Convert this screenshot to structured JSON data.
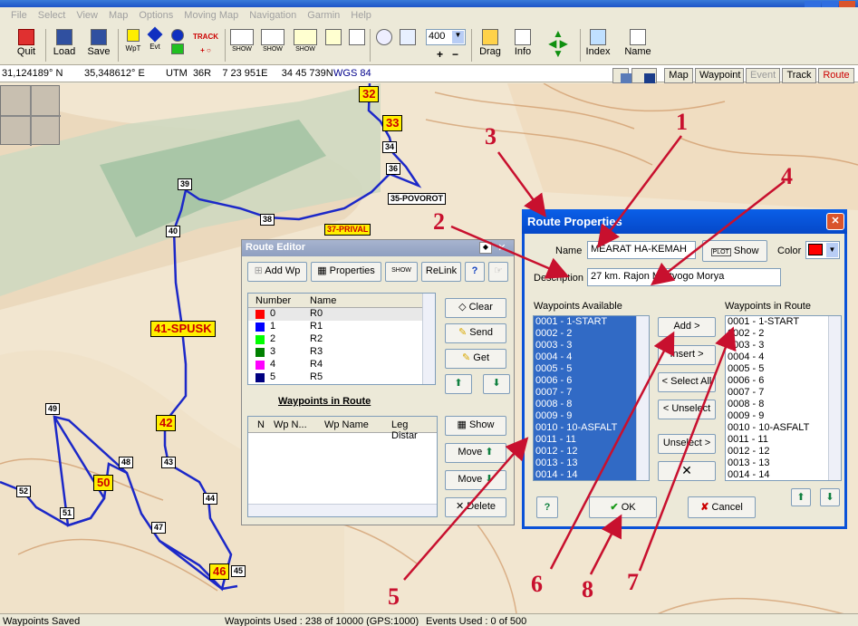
{
  "menu": [
    "File",
    "Select",
    "View",
    "Map",
    "Options",
    "Moving Map",
    "Navigation",
    "Garmin",
    "Help"
  ],
  "toolbar": {
    "quit": "Quit",
    "load": "Load",
    "save": "Save",
    "wpt": "WpT",
    "evt": "Evt",
    "track": "TRACK",
    "show": "SHOW",
    "zoom": "400",
    "drag": "Drag",
    "info": "Info",
    "index": "Index",
    "name": "Name"
  },
  "coords": {
    "lat": "31,124189° N",
    "lon": "35,348612° E",
    "utm": "UTM  36R    7 23 951E     34 45 739N",
    "datum": "WGS 84"
  },
  "tabs": [
    "Map",
    "Waypoint",
    "Event",
    "Track",
    "Route"
  ],
  "status": {
    "left": "Waypoints Saved",
    "used": "Waypoints Used : 238 of 10000  (GPS:1000)",
    "events": "Events Used : 0 of 500"
  },
  "map_labels": {
    "w32": "32",
    "w33": "33",
    "w34": "34",
    "w36": "36",
    "w35": "35-POVOROT",
    "w37": "37-PRIVAL",
    "w38": "38",
    "w39": "39",
    "w40": "40",
    "w41": "41-SPUSK",
    "w42": "42",
    "w43": "43",
    "w44": "44",
    "w45": "45",
    "w46": "46",
    "w47": "47",
    "w48": "48",
    "w49": "49",
    "w50": "50",
    "w51": "51",
    "w52": "52"
  },
  "route_editor": {
    "title": "Route Editor",
    "add_wp": "Add Wp",
    "properties": "Properties",
    "show": "SHOW",
    "relink": "ReLink",
    "help": "?",
    "col_number": "Number",
    "col_name": "Name",
    "routes": [
      {
        "n": "0",
        "name": "R0",
        "color": "#ff0000"
      },
      {
        "n": "1",
        "name": "R1",
        "color": "#0000ff"
      },
      {
        "n": "2",
        "name": "R2",
        "color": "#00ff00"
      },
      {
        "n": "3",
        "name": "R3",
        "color": "#008000"
      },
      {
        "n": "4",
        "name": "R4",
        "color": "#ff00ff"
      },
      {
        "n": "5",
        "name": "R5",
        "color": "#000080"
      }
    ],
    "clear": "Clear",
    "send": "Send",
    "get": "Get",
    "wir_title": "Waypoints in Route",
    "wir_cols": [
      "N",
      "Wp N...",
      "Wp Name",
      "Leg Distar"
    ],
    "show_btn": "Show",
    "move_up": "Move",
    "move_down": "Move",
    "delete": "Delete"
  },
  "route_props": {
    "title": "Route Properties",
    "name_label": "Name",
    "name": "MEARAT HA-KEMAH",
    "show": "Show",
    "plot": "PLOT",
    "color_label": "Color",
    "color": "#ff0000",
    "desc_label": "Description",
    "desc": "27 km. Rajon Mertvogo Morya",
    "avail_title": "Waypoints Available",
    "in_route_title": "Waypoints in Route",
    "available": [
      "0001 - 1-START",
      "0002 - 2",
      "0003 - 3",
      "0004 - 4",
      "0005 - 5",
      "0006 - 6",
      "0007 - 7",
      "0008 - 8",
      "0009 - 9",
      "0010 - 10-ASFALT",
      "0011 - 11",
      "0012 - 12",
      "0013 - 13",
      "0014 - 14"
    ],
    "in_route": [
      "0001 - 1-START",
      "0002 - 2",
      "0003 - 3",
      "0004 - 4",
      "0005 - 5",
      "0006 - 6",
      "0007 - 7",
      "0008 - 8",
      "0009 - 9",
      "0010 - 10-ASFALT",
      "0011 - 11",
      "0012 - 12",
      "0013 - 13",
      "0014 - 14"
    ],
    "add": "Add >",
    "insert": "Insert >",
    "select_all": "< Select All",
    "unselect": "< Unselect",
    "unselect2": "Unselect >",
    "cross": "✕",
    "help": "?",
    "ok": "OK",
    "cancel": "Cancel"
  },
  "markers": [
    "1",
    "2",
    "3",
    "4",
    "5",
    "6",
    "7",
    "8"
  ]
}
